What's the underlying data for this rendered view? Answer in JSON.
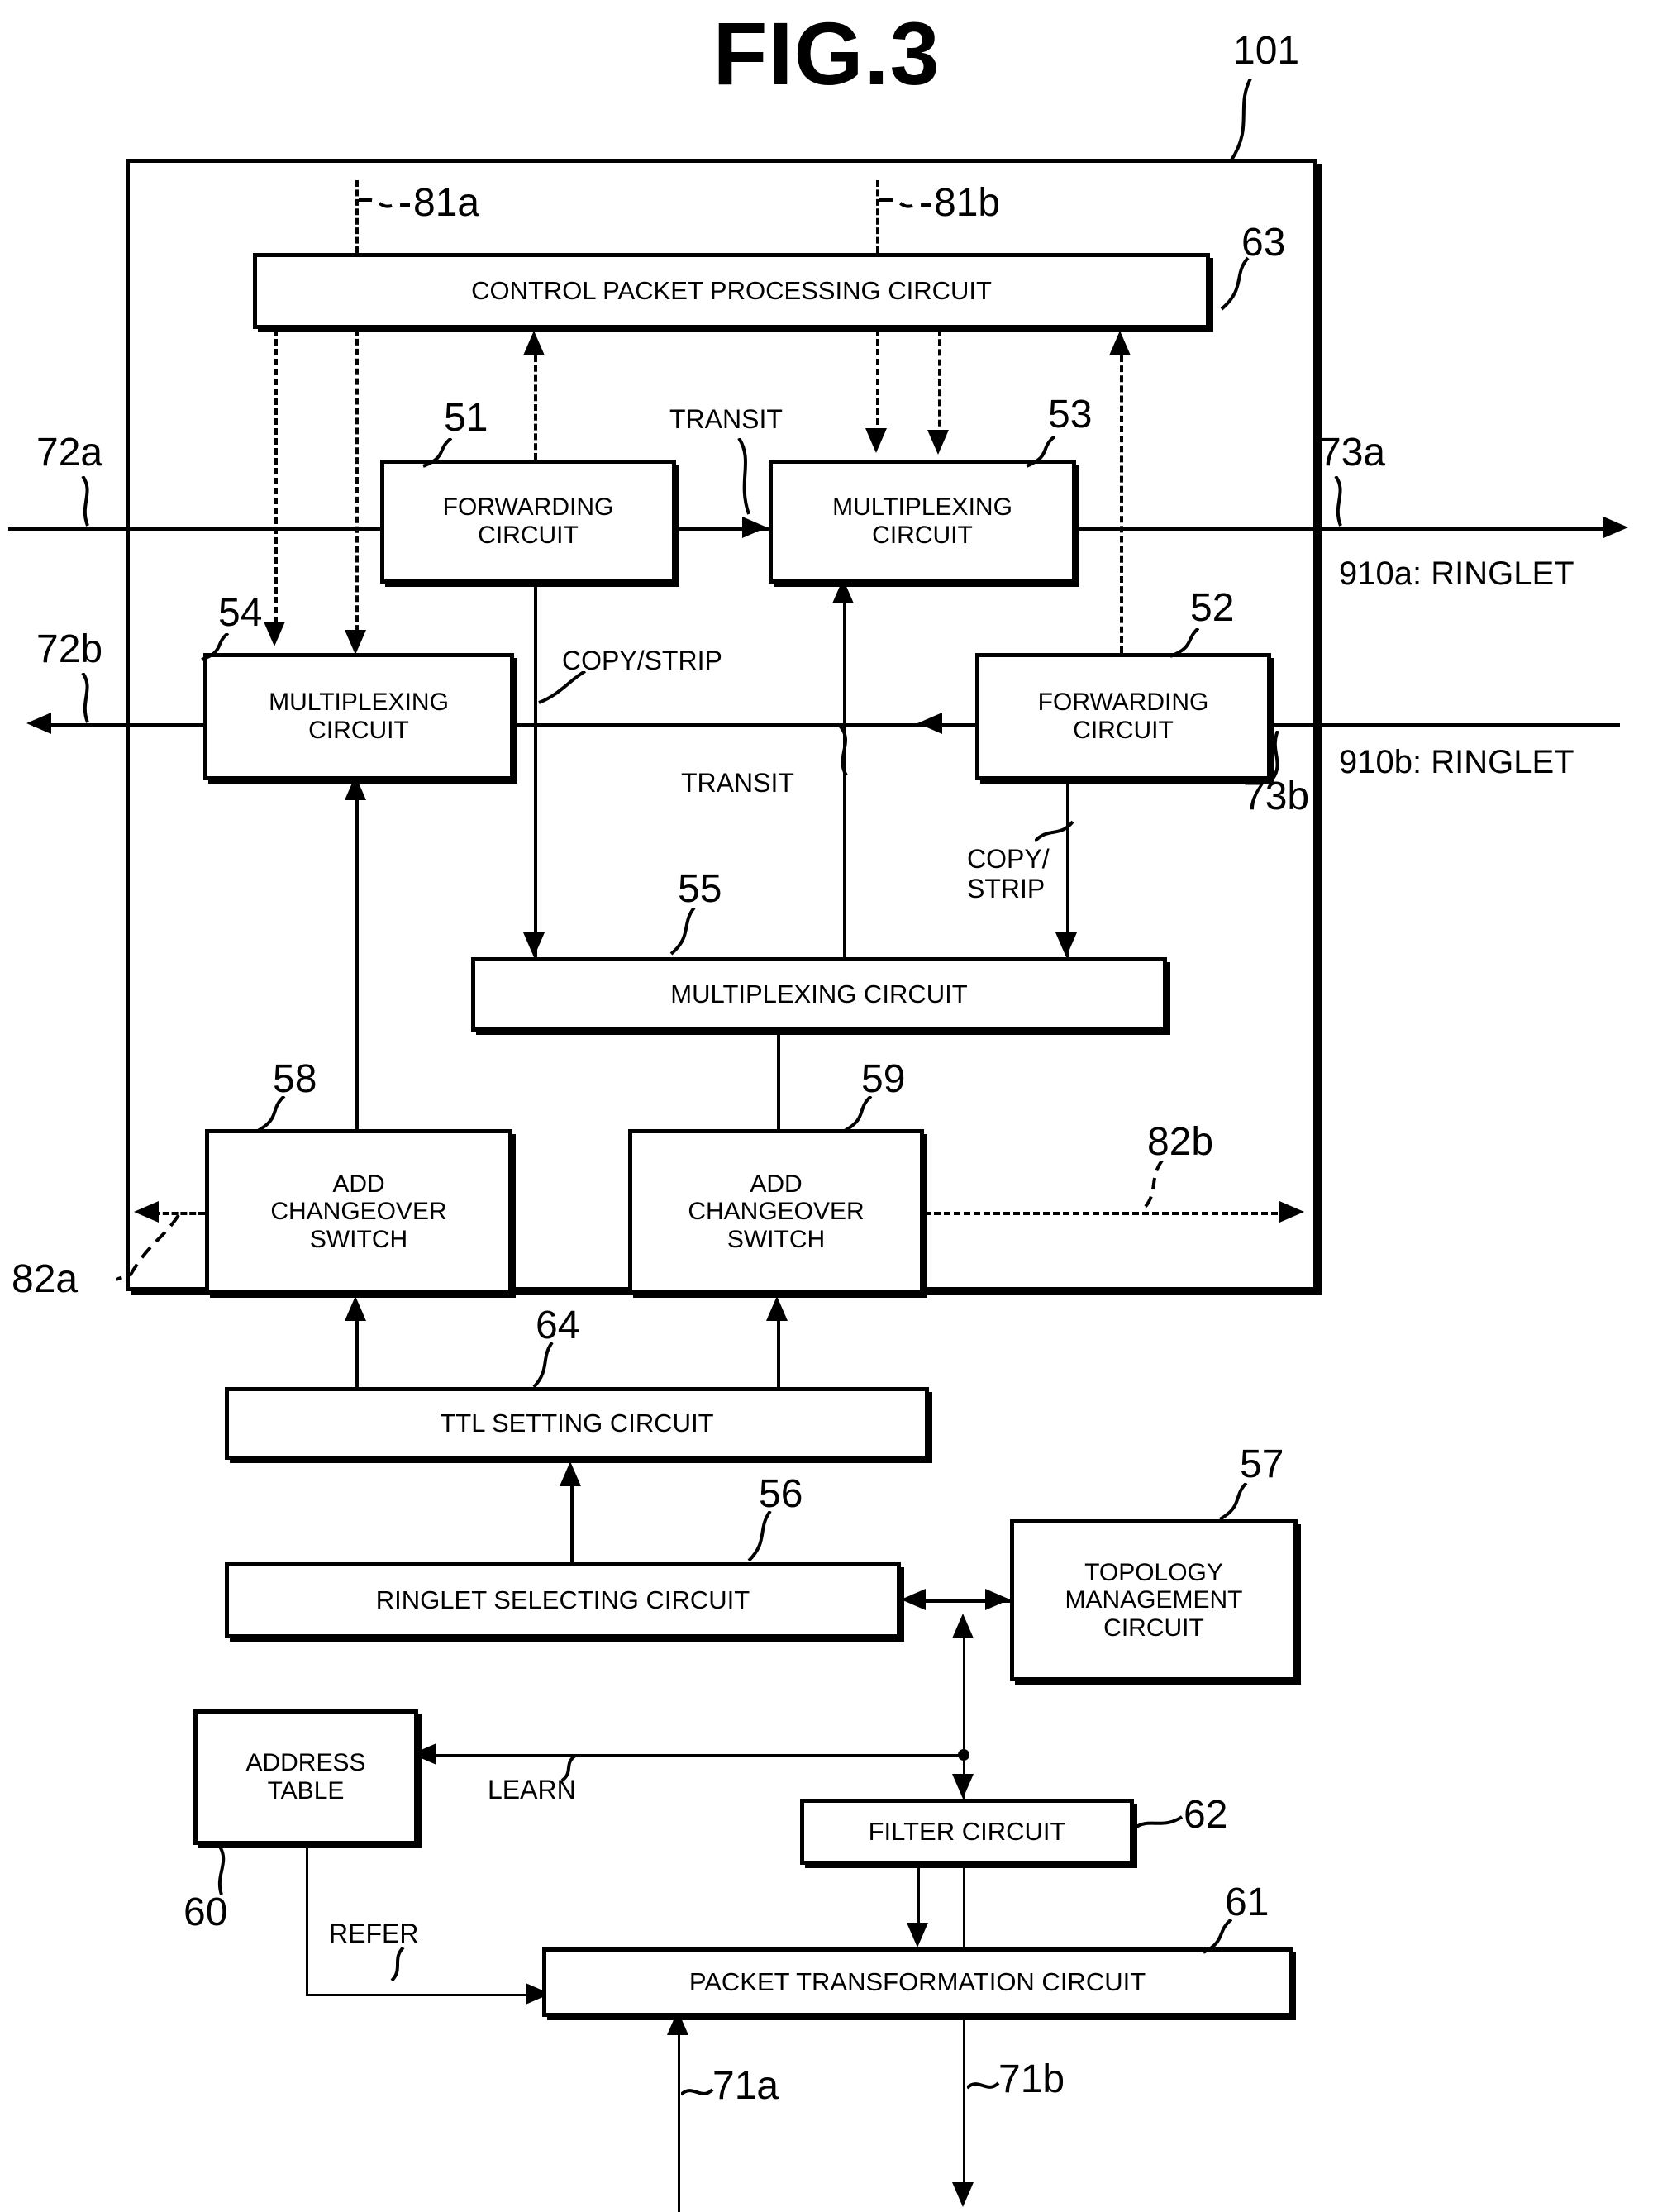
{
  "figure": {
    "title": "FIG.3",
    "device_ref": "101"
  },
  "blocks": [
    {
      "id": "b63",
      "label": "CONTROL PACKET PROCESSING CIRCUIT",
      "ref": "63"
    },
    {
      "id": "b51",
      "label": "FORWARDING\nCIRCUIT",
      "ref": "51"
    },
    {
      "id": "b53",
      "label": "MULTIPLEXING\nCIRCUIT",
      "ref": "53"
    },
    {
      "id": "b54",
      "label": "MULTIPLEXING\nCIRCUIT",
      "ref": "54"
    },
    {
      "id": "b52",
      "label": "FORWARDING\nCIRCUIT",
      "ref": "52"
    },
    {
      "id": "b55",
      "label": "MULTIPLEXING CIRCUIT",
      "ref": "55"
    },
    {
      "id": "b58",
      "label": "ADD\nCHANGEOVER\nSWITCH",
      "ref": "58"
    },
    {
      "id": "b59",
      "label": "ADD\nCHANGEOVER\nSWITCH",
      "ref": "59"
    },
    {
      "id": "b64",
      "label": "TTL SETTING CIRCUIT",
      "ref": "64"
    },
    {
      "id": "b56",
      "label": "RINGLET SELECTING CIRCUIT",
      "ref": "56"
    },
    {
      "id": "b57",
      "label": "TOPOLOGY\nMANAGEMENT\nCIRCUIT",
      "ref": "57"
    },
    {
      "id": "b60",
      "label": "ADDRESS\nTABLE",
      "ref": "60"
    },
    {
      "id": "b62",
      "label": "FILTER CIRCUIT",
      "ref": "62"
    },
    {
      "id": "b61",
      "label": "PACKET TRANSFORMATION CIRCUIT",
      "ref": "61"
    }
  ],
  "block_labels": {
    "b63": "CONTROL PACKET PROCESSING CIRCUIT",
    "b51_l1": "FORWARDING",
    "b51_l2": "CIRCUIT",
    "b53_l1": "MULTIPLEXING",
    "b53_l2": "CIRCUIT",
    "b54_l1": "MULTIPLEXING",
    "b54_l2": "CIRCUIT",
    "b52_l1": "FORWARDING",
    "b52_l2": "CIRCUIT",
    "b55": "MULTIPLEXING CIRCUIT",
    "b58_l1": "ADD",
    "b58_l2": "CHANGEOVER",
    "b58_l3": "SWITCH",
    "b59_l1": "ADD",
    "b59_l2": "CHANGEOVER",
    "b59_l3": "SWITCH",
    "b64": "TTL SETTING CIRCUIT",
    "b56": "RINGLET SELECTING CIRCUIT",
    "b57_l1": "TOPOLOGY",
    "b57_l2": "MANAGEMENT",
    "b57_l3": "CIRCUIT",
    "b60_l1": "ADDRESS",
    "b60_l2": "TABLE",
    "b62": "FILTER CIRCUIT",
    "b61": "PACKET TRANSFORMATION CIRCUIT"
  },
  "refs": {
    "r101": "101",
    "r63": "63",
    "r81a": "81a",
    "r81b": "81b",
    "r51": "51",
    "r53": "53",
    "r54": "54",
    "r52": "52",
    "r55": "55",
    "r58": "58",
    "r59": "59",
    "r64": "64",
    "r56": "56",
    "r57": "57",
    "r60": "60",
    "r62": "62",
    "r61": "61",
    "r72a": "72a",
    "r72b": "72b",
    "r73a": "73a",
    "r73b": "73b",
    "r82a": "82a",
    "r82b": "82b",
    "r71a": "71a",
    "r71b": "71b"
  },
  "annotations": {
    "transit_top": "TRANSIT",
    "transit_mid": "TRANSIT",
    "copy_strip_left": "COPY/STRIP",
    "copy_strip_right_l1": "COPY/",
    "copy_strip_right_l2": "STRIP",
    "learn": "LEARN",
    "refer": "REFER",
    "ringlet_a": "910a: RINGLET",
    "ringlet_b": "910b: RINGLET"
  },
  "colors": {
    "line": "#000000",
    "background": "#ffffff"
  }
}
